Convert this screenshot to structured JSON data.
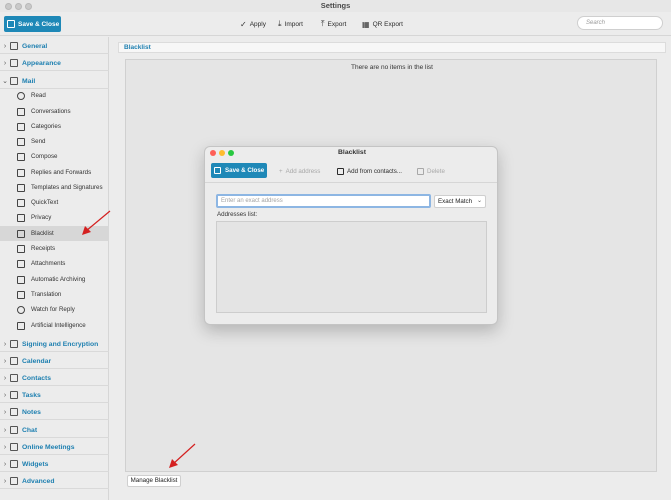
{
  "window": {
    "title": "Settings"
  },
  "toolbar": {
    "save_close": "Save & Close",
    "apply": "Apply",
    "import": "Import",
    "export": "Export",
    "qr_export": "QR Export",
    "search_placeholder": "Search"
  },
  "sidebar": {
    "sections_top": [
      {
        "label": "General",
        "icon": "gear-icon"
      },
      {
        "label": "Appearance",
        "icon": "brush-icon"
      },
      {
        "label": "Mail",
        "icon": "envelope-icon"
      }
    ],
    "mail_items": [
      {
        "label": "Read",
        "icon": "eye-icon"
      },
      {
        "label": "Conversations",
        "icon": "chat-bubbles-icon"
      },
      {
        "label": "Categories",
        "icon": "grid-icon"
      },
      {
        "label": "Send",
        "icon": "paper-plane-icon"
      },
      {
        "label": "Compose",
        "icon": "pencil-icon"
      },
      {
        "label": "Replies and Forwards",
        "icon": "reply-icon"
      },
      {
        "label": "Templates and Signatures",
        "icon": "template-icon"
      },
      {
        "label": "QuickText",
        "icon": "quicktext-icon"
      },
      {
        "label": "Privacy",
        "icon": "shield-icon"
      },
      {
        "label": "Blacklist",
        "icon": "blacklist-icon"
      },
      {
        "label": "Receipts",
        "icon": "receipt-icon"
      },
      {
        "label": "Attachments",
        "icon": "paperclip-icon"
      },
      {
        "label": "Automatic Archiving",
        "icon": "archive-icon"
      },
      {
        "label": "Translation",
        "icon": "translate-icon"
      },
      {
        "label": "Watch for Reply",
        "icon": "watch-eye-icon"
      },
      {
        "label": "Artificial Intelligence",
        "icon": "ai-icon"
      }
    ],
    "sections_bottom": [
      {
        "label": "Signing and Encryption",
        "icon": "lock-icon"
      },
      {
        "label": "Calendar",
        "icon": "calendar-icon"
      },
      {
        "label": "Contacts",
        "icon": "contact-icon"
      },
      {
        "label": "Tasks",
        "icon": "tasks-icon"
      },
      {
        "label": "Notes",
        "icon": "notes-icon"
      },
      {
        "label": "Chat",
        "icon": "chat-icon"
      },
      {
        "label": "Online Meetings",
        "icon": "video-icon"
      },
      {
        "label": "Widgets",
        "icon": "widgets-icon"
      },
      {
        "label": "Advanced",
        "icon": "advanced-gear-icon"
      }
    ],
    "active_item": "Blacklist"
  },
  "main": {
    "pane_title": "Blacklist",
    "empty_message": "There are no items in the list",
    "manage_button": "Manage Blacklist"
  },
  "dialog": {
    "title": "Blacklist",
    "save_close": "Save & Close",
    "add_address": "Add address",
    "add_from_contacts": "Add from contacts...",
    "delete": "Delete",
    "input_placeholder": "Enter an exact address",
    "match_mode": "Exact Match",
    "addresses_label": "Addresses list:"
  },
  "colors": {
    "accent": "#1e88b7",
    "section_label": "#1d7fb0",
    "arrow": "#d42020",
    "close_dot": "#fe5f57",
    "min_dot": "#febc2e",
    "max_dot": "#28c840"
  }
}
